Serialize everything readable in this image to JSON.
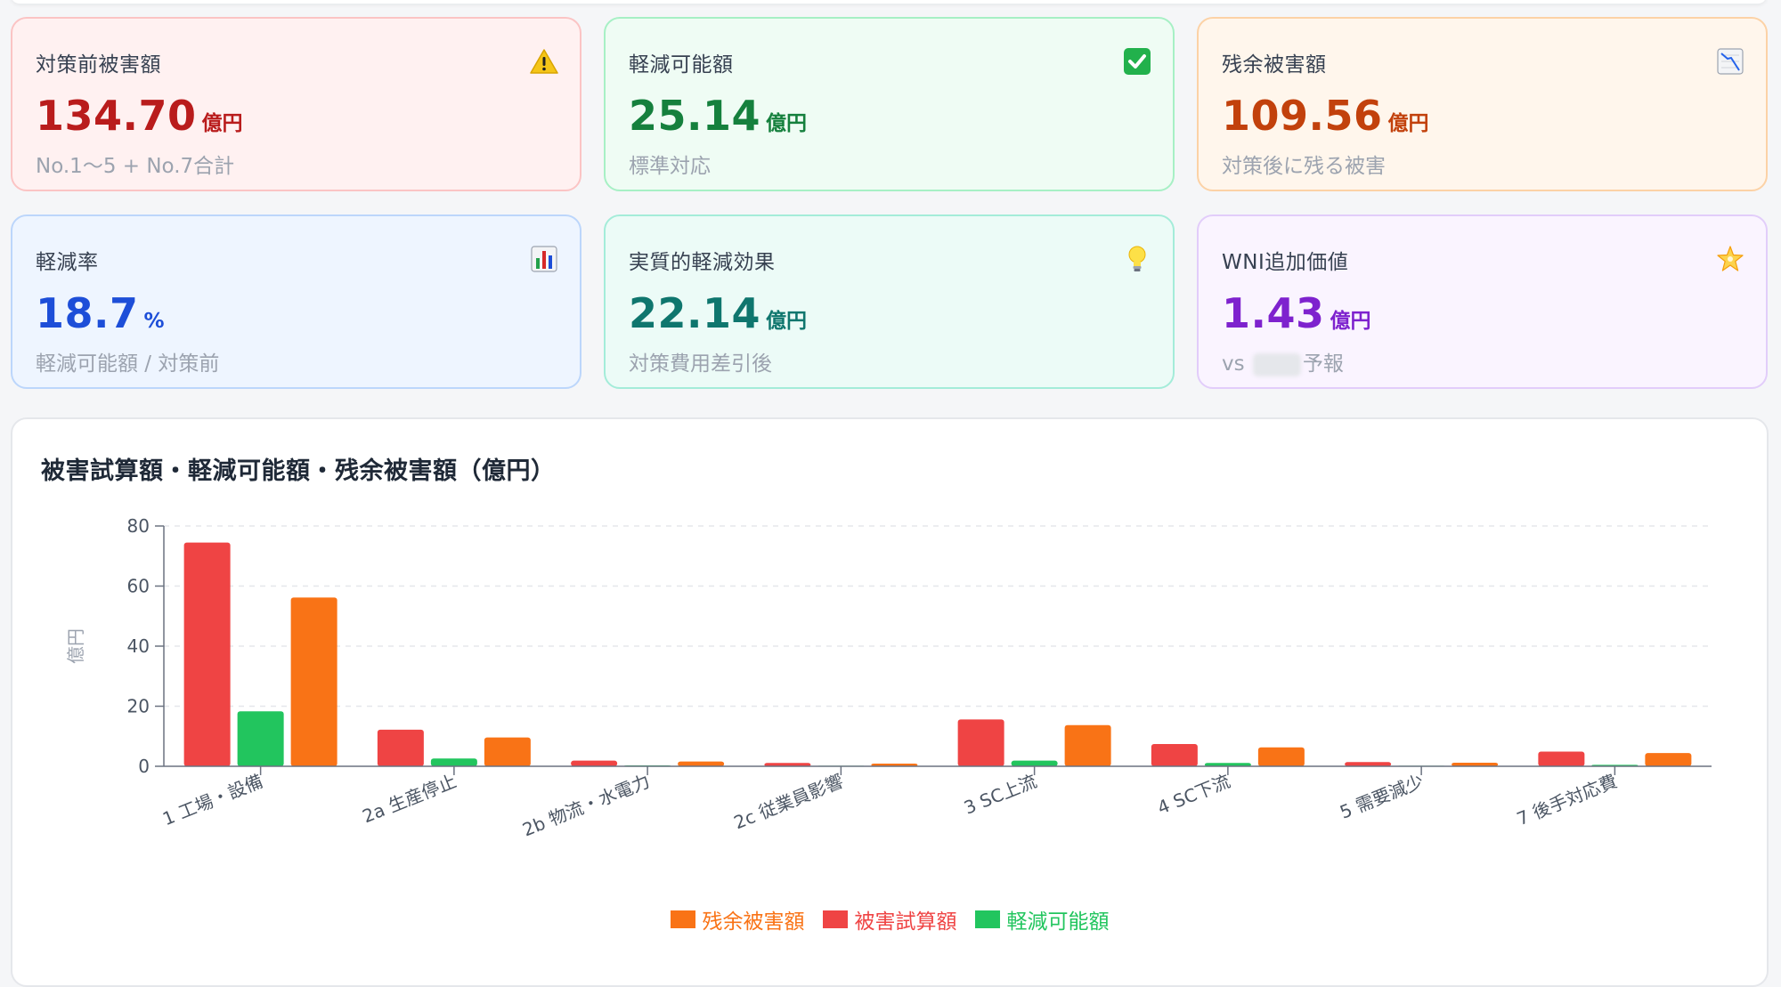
{
  "cards": [
    {
      "label": "対策前被害額",
      "value": "134.70",
      "unit": "億円",
      "sub": "No.1〜5 + No.7合計",
      "icon": "warning-icon"
    },
    {
      "label": "軽減可能額",
      "value": "25.14",
      "unit": "億円",
      "sub": "標準対応",
      "icon": "check-icon"
    },
    {
      "label": "残余被害額",
      "value": "109.56",
      "unit": "億円",
      "sub": "対策後に残る被害",
      "icon": "chart-down-icon"
    },
    {
      "label": "軽減率",
      "value": "18.7",
      "unit": "%",
      "sub": "軽減可能額 / 対策前",
      "icon": "bar-chart-icon"
    },
    {
      "label": "実質的軽減効果",
      "value": "22.14",
      "unit": "億円",
      "sub": "対策費用差引後",
      "icon": "lightbulb-icon"
    },
    {
      "label": "WNI追加価値",
      "value": "1.43",
      "unit": "億円",
      "sub_prefix": "vs",
      "sub_suffix": "予報",
      "icon": "star-icon"
    }
  ],
  "chart_title": "被害試算額・軽減可能額・残余被害額（億円）",
  "chart_data": {
    "type": "bar",
    "categories": [
      "1 工場・設備",
      "2a 生産停止",
      "2b 物流・水電力",
      "2c 従業員影響",
      "3 SC上流",
      "4 SC下流",
      "5 需要減少",
      "7 後手対応費"
    ],
    "series": [
      {
        "name": "被害試算額",
        "color": "#ef4444",
        "values": [
          74.5,
          12.2,
          1.9,
          1.1,
          15.6,
          7.4,
          1.4,
          4.9
        ]
      },
      {
        "name": "軽減可能額",
        "color": "#22c55e",
        "values": [
          18.3,
          2.6,
          0.3,
          0.2,
          1.9,
          1.1,
          0.2,
          0.5
        ]
      },
      {
        "name": "残余被害額",
        "color": "#f97316",
        "values": [
          56.2,
          9.6,
          1.6,
          0.9,
          13.7,
          6.3,
          1.2,
          4.4
        ]
      }
    ],
    "legend_order": [
      "残余被害額",
      "被害試算額",
      "軽減可能額"
    ],
    "ylabel": "億円",
    "ylim": [
      0,
      80
    ],
    "yticks": [
      0,
      20,
      40,
      60,
      80
    ],
    "grid": true,
    "legend": "bottom"
  }
}
